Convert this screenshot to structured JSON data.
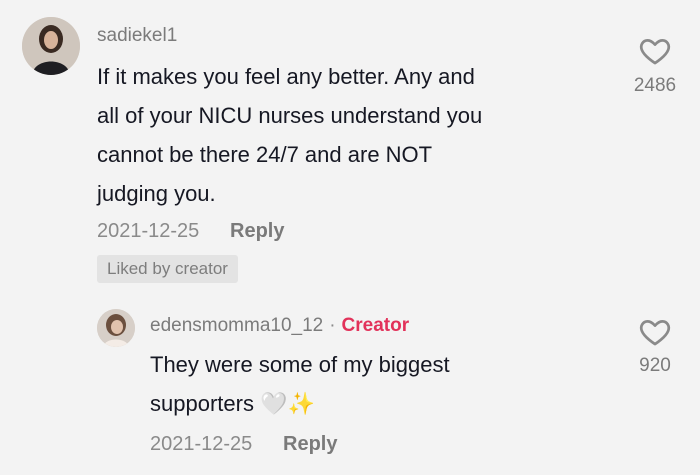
{
  "comments": [
    {
      "username": "sadiekel1",
      "text_lines": [
        "If it makes you feel any better. Any and",
        "all of your NICU nurses understand you",
        "cannot be there 24/7 and are NOT",
        "judging you."
      ],
      "date": "2021-12-25",
      "reply_label": "Reply",
      "badge": "Liked by creator",
      "likes": "2486"
    },
    {
      "username": "edensmomma10_12",
      "separator": "·",
      "tag": "Creator",
      "text_lines": [
        "They were some of my biggest",
        "supporters"
      ],
      "emoji": "🤍✨",
      "date": "2021-12-25",
      "reply_label": "Reply",
      "likes": "920"
    }
  ],
  "icons": {
    "like": "heart-outline-icon"
  },
  "colors": {
    "background": "#f3f3f3",
    "text": "#161823",
    "muted": "#7b7b7b",
    "creator": "#e2325a"
  }
}
